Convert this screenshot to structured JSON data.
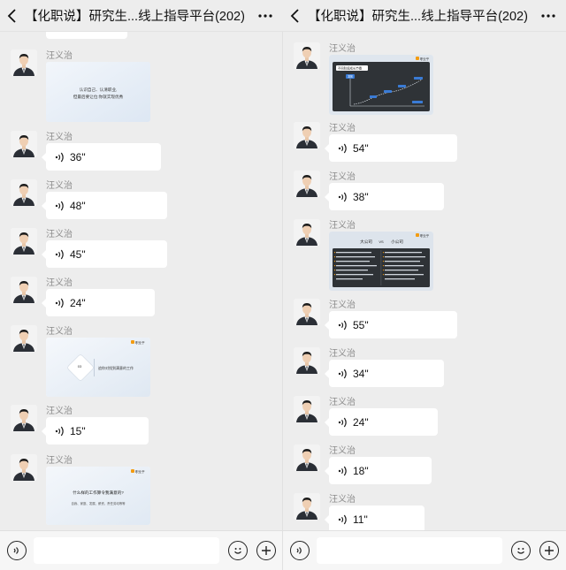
{
  "window": {
    "title": "【化职说】研究生...线上指导平台(202)"
  },
  "sender_name": "汪义治",
  "left": {
    "messages": [
      {
        "kind": "image",
        "slide": {
          "line1": "认识自己、认清职业,",
          "line2": "但最后要让位:你就实现优秀"
        }
      },
      {
        "kind": "voice",
        "duration": "36\""
      },
      {
        "kind": "voice",
        "duration": "48\""
      },
      {
        "kind": "voice",
        "duration": "45\""
      },
      {
        "kind": "voice",
        "duration": "24\""
      },
      {
        "kind": "image",
        "slide": {
          "logo": "职业乎",
          "badge_num": "03",
          "caption": "追你对找到满意的工作"
        }
      },
      {
        "kind": "voice",
        "duration": "15\""
      },
      {
        "kind": "image",
        "slide": {
          "logo": "职业乎",
          "line1": "什么样的工作算令我满意的?",
          "line2": "自我、家庭、发展、薪资、责任劳动等等"
        }
      }
    ]
  },
  "right": {
    "messages": [
      {
        "kind": "image",
        "slide": {
          "logo": "职业乎",
          "title": "不同阶段成长节奏",
          "tag": "发展"
        }
      },
      {
        "kind": "voice",
        "duration": "54\""
      },
      {
        "kind": "voice",
        "duration": "38\""
      },
      {
        "kind": "image",
        "slide": {
          "logo": "职业乎",
          "left_title": "大公司",
          "vs": "VS",
          "right_title": "小公司"
        }
      },
      {
        "kind": "voice",
        "duration": "55\""
      },
      {
        "kind": "voice",
        "duration": "34\""
      },
      {
        "kind": "voice",
        "duration": "24\""
      },
      {
        "kind": "voice",
        "duration": "18\""
      },
      {
        "kind": "voice",
        "duration": "11\""
      }
    ]
  },
  "input": {
    "placeholder": ""
  },
  "colors": {
    "background": "#ededed",
    "bubble": "#ffffff",
    "logo_accent": "#f39c12"
  }
}
